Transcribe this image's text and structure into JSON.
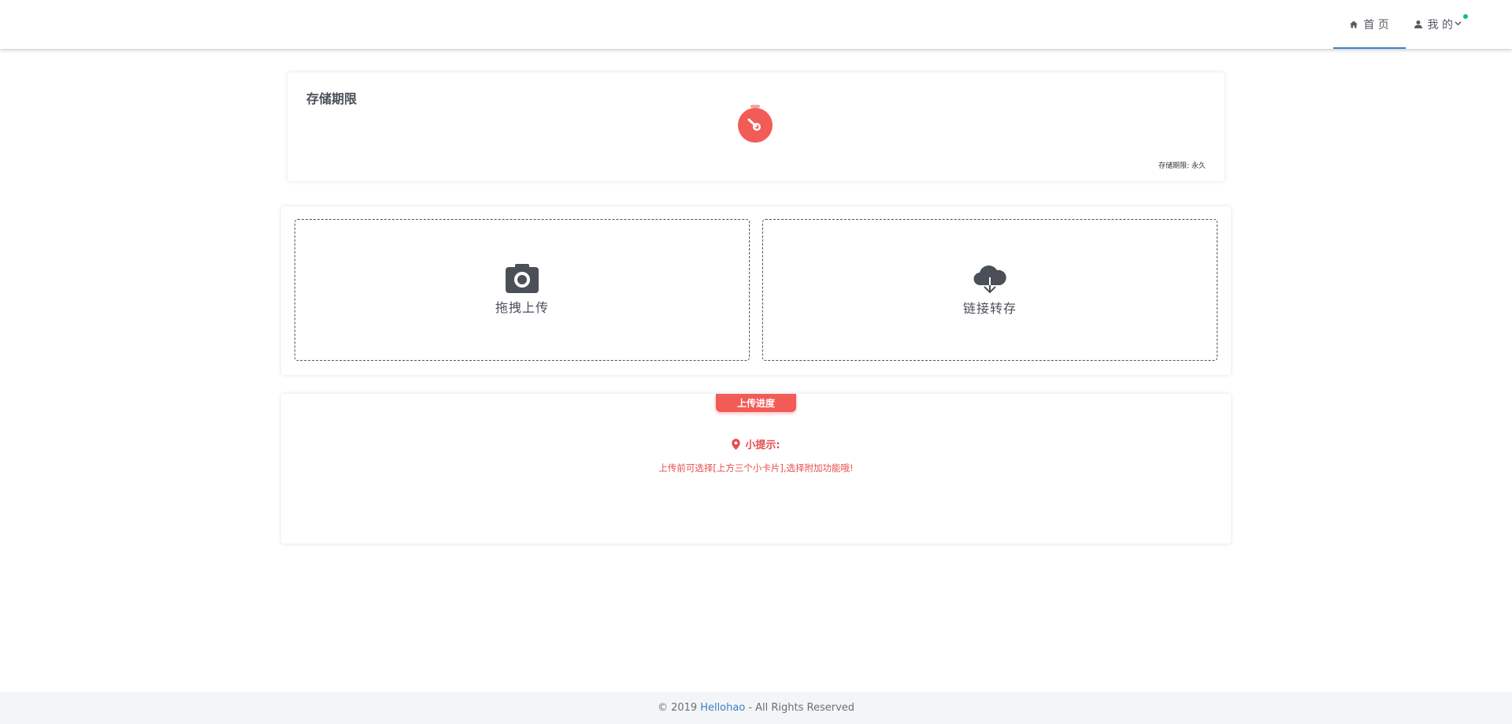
{
  "nav": {
    "home_label": "首 页",
    "mine_label": "我 的",
    "accent_color": "#3b82c4",
    "notification_color": "#13c26b"
  },
  "storage": {
    "title": "存储期限",
    "note": "存储期限: 永久",
    "timer_color": "#f35b57"
  },
  "upload": {
    "drag_label": "拖拽上传",
    "link_label": "链接转存"
  },
  "progress": {
    "tab_label": "上传进度",
    "tip_title": "小提示:",
    "tip_text": "上传前可选择[上方三个小卡片],选择附加功能哦!"
  },
  "footer": {
    "prefix": "© 2019",
    "brand": "Hellohao",
    "suffix": "- All Rights Reserved"
  }
}
